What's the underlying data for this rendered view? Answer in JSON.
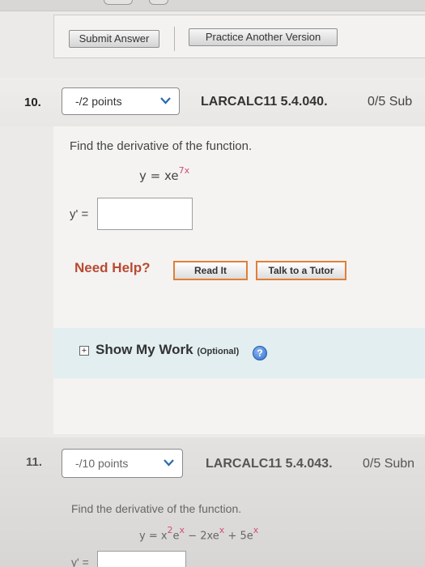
{
  "actions": {
    "submit_label": "Submit Answer",
    "practice_label": "Practice Another Version"
  },
  "question10": {
    "number": "10.",
    "points": "-/2 points",
    "code": "LARCALC11 5.4.040.",
    "score": "0/5 Sub",
    "prompt": "Find the derivative of the function.",
    "equation_base": "y = xe",
    "equation_exp": "7x",
    "answer_label": "y' =",
    "answer_value": ""
  },
  "help": {
    "need_help": "Need Help?",
    "read_it": "Read It",
    "talk_tutor": "Talk to a Tutor"
  },
  "show_my_work": {
    "title": "Show My Work",
    "optional": "(Optional)",
    "help_icon": "?"
  },
  "question11": {
    "number": "11.",
    "points": "-/10 points",
    "code": "LARCALC11 5.4.043.",
    "score": "0/5 Subn",
    "prompt": "Find the derivative of the function.",
    "eq_part1": "y = x",
    "eq_exp1": "2",
    "eq_part2": "e",
    "eq_exp2": "x",
    "eq_part3": " − 2xe",
    "eq_exp3": "x",
    "eq_part4": " + 5e",
    "eq_exp4": "x",
    "answer_label": "y' ="
  },
  "colors": {
    "need_help": "#b84a33",
    "button_border": "#e07f39",
    "exponent_accent": "#d14d7c",
    "help_circle": "#2e6fd0"
  }
}
